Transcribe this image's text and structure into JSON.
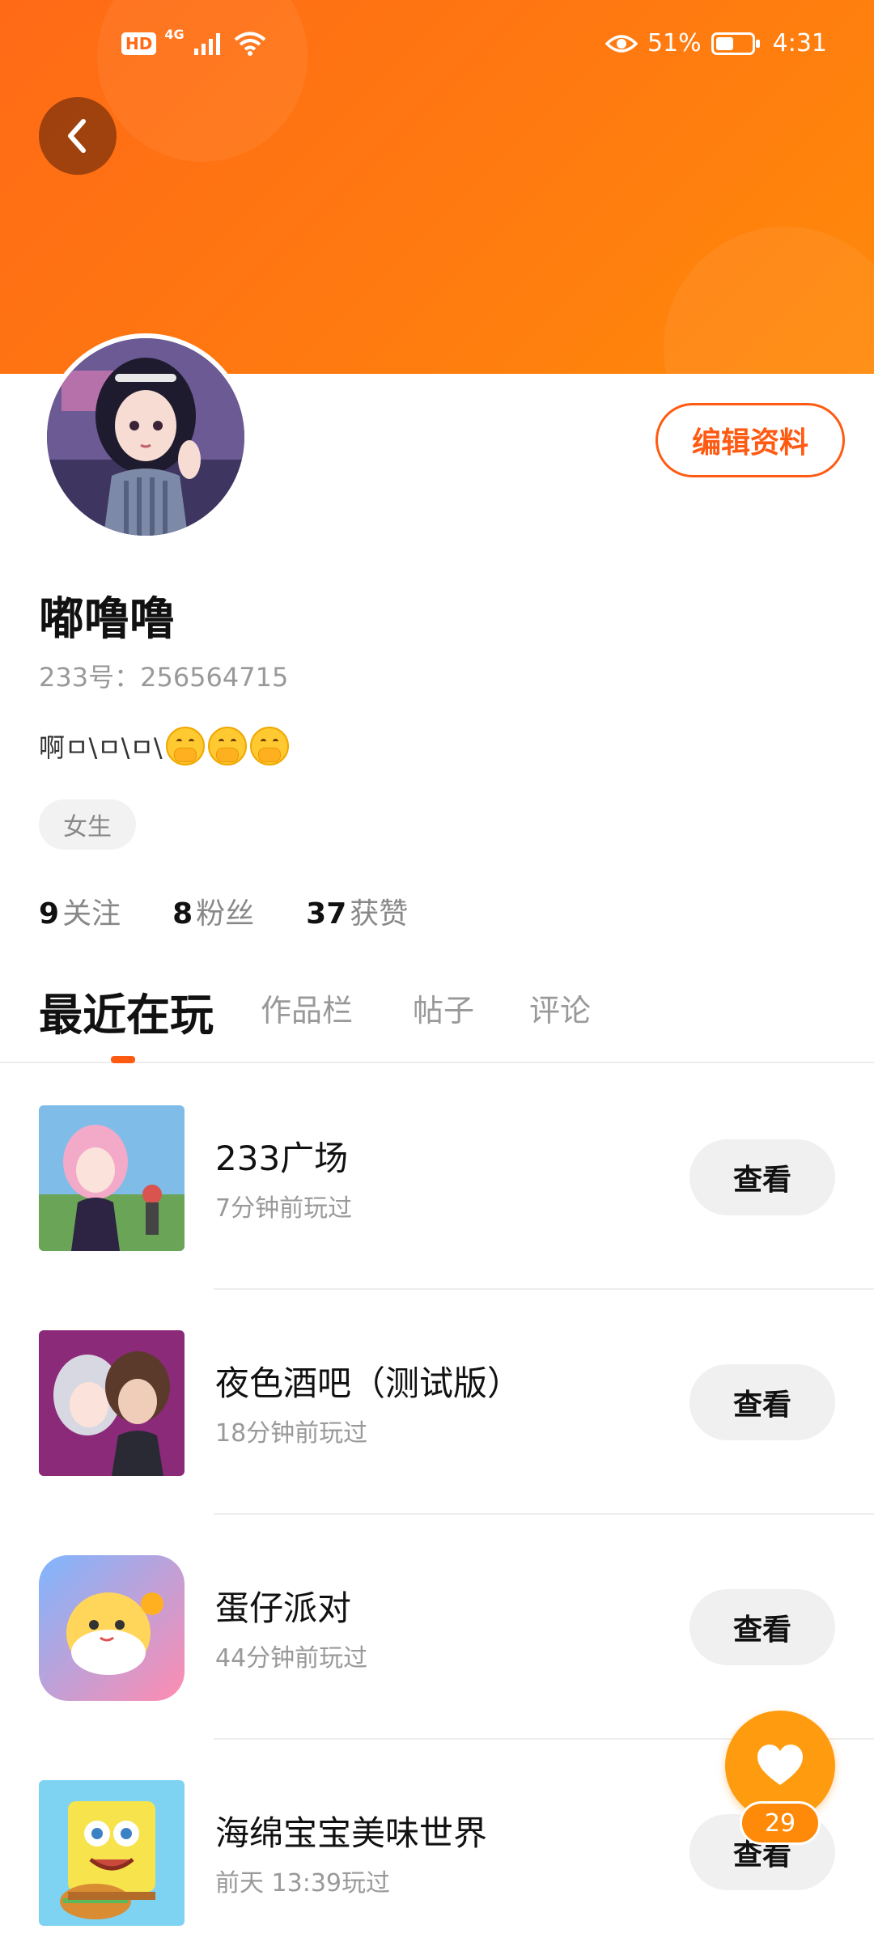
{
  "status_bar": {
    "hd": "HD",
    "network": "4G",
    "battery_percent": "51%",
    "battery_level": 0.51,
    "time": "4:31"
  },
  "header": {
    "back_icon": "chevron-left-icon"
  },
  "profile": {
    "edit_label": "编辑资料",
    "nickname": "嘟噜噜",
    "id_label": "233号：",
    "id_value": "256564715",
    "bio_text": "啊ㅁ\\ㅁ\\ㅁ\\",
    "bio_emojis": [
      "face-with-hand-over-mouth",
      "face-with-hand-over-mouth",
      "face-with-hand-over-mouth"
    ],
    "gender": "女生"
  },
  "stats": [
    {
      "num": "9",
      "label": "关注"
    },
    {
      "num": "8",
      "label": "粉丝"
    },
    {
      "num": "37",
      "label": "获赞"
    }
  ],
  "tabs": [
    "最近在玩",
    "作品栏",
    "帖子",
    "评论"
  ],
  "games": [
    {
      "name": "233广场",
      "time": "7分钟前玩过",
      "button": "查看"
    },
    {
      "name": "夜色酒吧（测试版）",
      "time": "18分钟前玩过",
      "button": "查看"
    },
    {
      "name": "蛋仔派对",
      "time": "44分钟前玩过",
      "button": "查看"
    },
    {
      "name": "海绵宝宝美味世界",
      "time": "前天 13:39玩过",
      "button": "查看"
    }
  ],
  "like_fab": {
    "count": "29",
    "icon": "heart-icon"
  },
  "colors": {
    "accent": "#ff5a12",
    "header_start": "#ff6a16",
    "header_end": "#ff8a0a",
    "fab": "#ff9b0f"
  }
}
